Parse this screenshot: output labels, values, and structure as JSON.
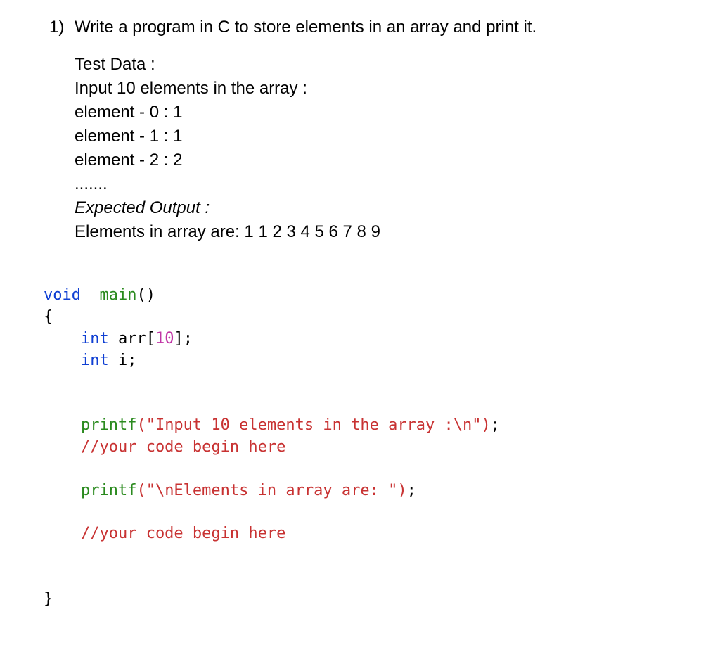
{
  "question": {
    "number": "1)",
    "title": "Write a program in C to store elements in an array and print it."
  },
  "test_data": {
    "label": "Test Data :",
    "input_line": "Input 10 elements in the array :",
    "elements": [
      "element - 0 : 1",
      "element - 1 : 1",
      "element - 2 : 2"
    ],
    "ellipsis": ".......",
    "expected_label": "Expected Output :",
    "expected_value": "Elements in array are: 1 1 2 3 4 5 6 7 8 9"
  },
  "code": {
    "l1_void": "void",
    "l1_main": "  main",
    "l1_parens": "()",
    "l2_brace": "{",
    "l3_int": "    int",
    "l3_arr": " arr[",
    "l3_num": "10",
    "l3_end": "];",
    "l4_int": "    int",
    "l4_i": " i;",
    "l5_blank": "",
    "l6_blank": "",
    "l7_printf": "    printf",
    "l7_str": "(\"Input 10 elements in the array :\\n\")",
    "l7_semi": ";",
    "l8_comment": "    //your code begin here",
    "l9_blank": "",
    "l10_printf": "    printf",
    "l10_str": "(\"\\nElements in array are: \")",
    "l10_semi": ";",
    "l11_blank": "",
    "l12_comment": "    //your code begin here",
    "l13_blank": "",
    "l14_blank": "",
    "l15_brace": "}"
  }
}
